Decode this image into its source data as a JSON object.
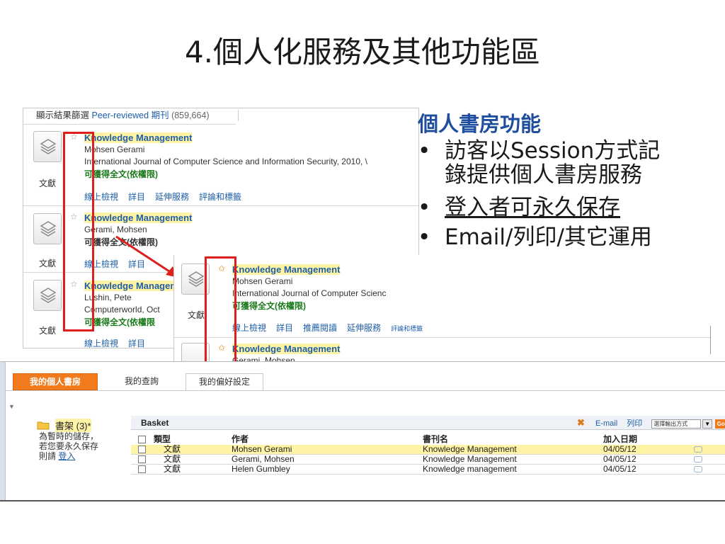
{
  "slide": {
    "title": "4.個人化服務及其他功能區"
  },
  "results_panel": {
    "filter_label": "顯示結果篩選",
    "filter_link": "Peer-reviewed 期刊",
    "filter_count": "(859,664)",
    "doc_type": "文獻",
    "results": [
      {
        "title": "Knowledge Management",
        "author": "Mohsen Gerami",
        "source": "International Journal of Computer Science and Information Security, 2010, \\",
        "fulltext": "可獲得全文(依權限)",
        "links": [
          "線上檢視",
          "詳目",
          "延伸服務",
          "評論和標籤"
        ]
      },
      {
        "title": "Knowledge Management",
        "author": "Gerami, Mohsen",
        "fulltext": "可獲得全文(依權限)",
        "links": [
          "線上檢視",
          "詳目"
        ]
      },
      {
        "title": "Knowledge Managemen",
        "author": "Lushin, Pete",
        "source": "Computerworld, Oct",
        "fulltext": "可獲得全文(依權限",
        "links": [
          "線上檢視",
          "詳目"
        ]
      }
    ]
  },
  "overlay_panel": {
    "doc_type": "文獻",
    "results": [
      {
        "title": "Knowledge Management",
        "author": "Mohsen Gerami",
        "source": "International Journal of Computer Scienc",
        "fulltext": "可獲得全文(依權限)",
        "links": [
          "線上檢視",
          "詳目",
          "推薦閱讀",
          "延伸服務",
          "評論和標籤"
        ]
      },
      {
        "title": "Knowledge Management",
        "author": "Gerami, Mohsen"
      }
    ]
  },
  "right_text": {
    "heading": "個人書房功能",
    "bullet_char": "•",
    "bullets": [
      {
        "line1": "訪客以Session方式記",
        "line2": "錄提供個人書房服務"
      },
      {
        "line1": "登入者可永久保存"
      },
      {
        "line1": "Email/列印/其它運用"
      }
    ]
  },
  "bookshelf_panel": {
    "tabs": [
      "我的個人書房",
      "我的查詢",
      "我的偏好設定"
    ],
    "shelf_name": "書架 (3)*",
    "shelf_note_1": "為暫時的儲存，",
    "shelf_note_2": "若您要永久保存",
    "shelf_note_3": "則請",
    "login_link": "登入",
    "basket_title": "Basket",
    "tools": {
      "email": "E-mail",
      "print": "列印",
      "select_placeholder": "選擇輸出方式",
      "go": "Go"
    },
    "columns": {
      "type": "類型",
      "author": "作者",
      "title": "書刊名",
      "date": "加入日期"
    },
    "rows": [
      {
        "type": "文獻",
        "author": "Mohsen Gerami",
        "title": "Knowledge Management",
        "date": "04/05/12"
      },
      {
        "type": "文獻",
        "author": "Gerami, Mohsen",
        "title": "Knowledge Management",
        "date": "04/05/12"
      },
      {
        "type": "文獻",
        "author": "Helen Gumbley",
        "title": "Knowledge management",
        "date": "04/05/12"
      }
    ]
  },
  "colors": {
    "accent_orange": "#f07a1c",
    "link_blue": "#1f5fa8",
    "annotation_red": "#e01e1e",
    "highlight_yellow": "#fff3a6"
  }
}
